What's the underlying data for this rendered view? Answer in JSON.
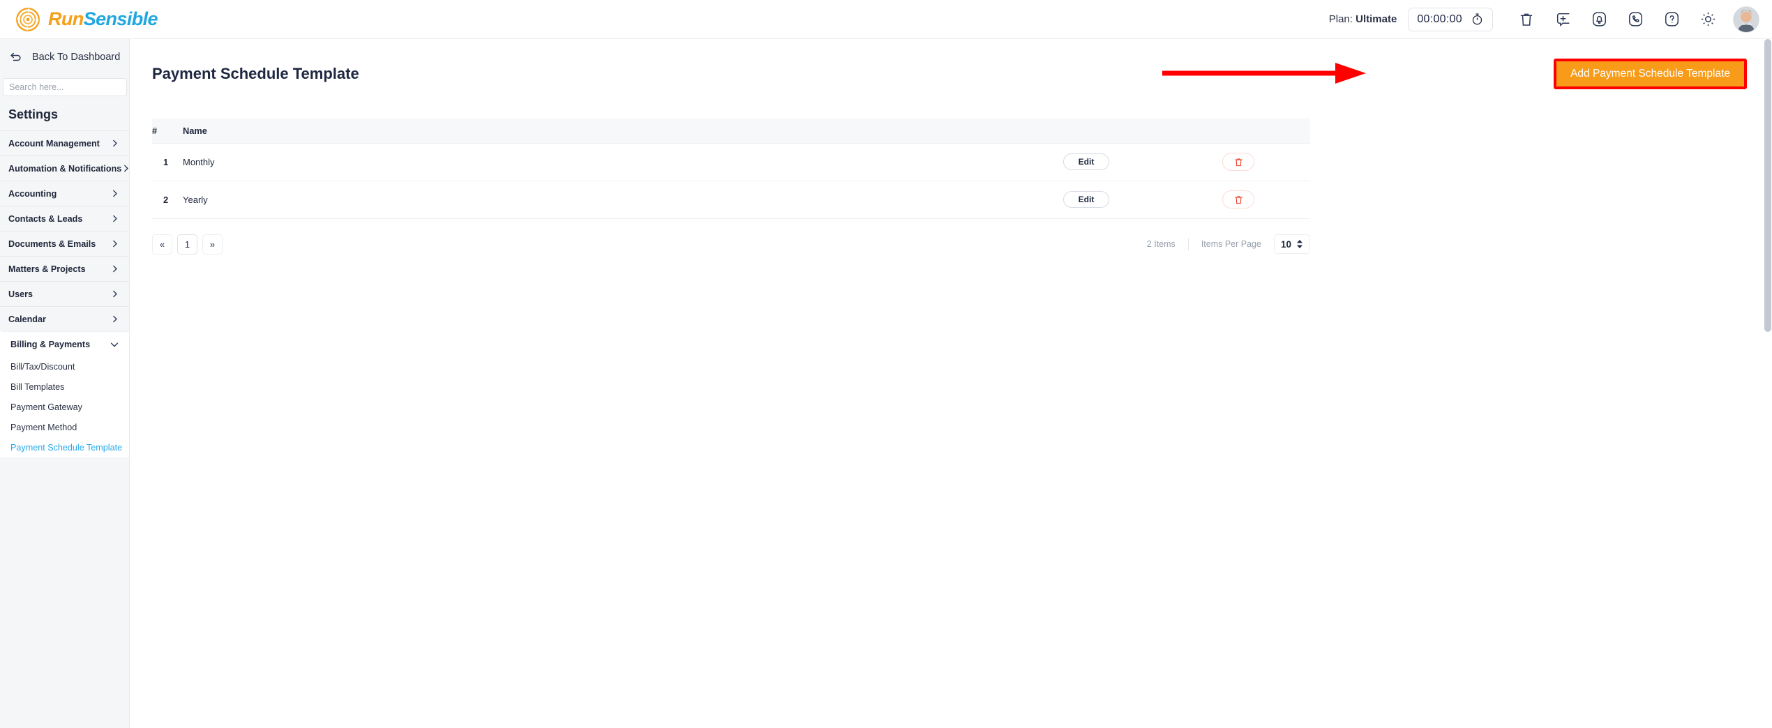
{
  "brand": {
    "run": "Run",
    "sensible": "Sensible"
  },
  "header": {
    "plan_prefix": "Plan:",
    "plan_value": "Ultimate",
    "timer": "00:00:00",
    "icons": [
      {
        "name": "stopwatch-icon"
      },
      {
        "name": "trash-icon"
      },
      {
        "name": "add-note-icon"
      },
      {
        "name": "notification-bell-icon"
      },
      {
        "name": "phone-icon"
      },
      {
        "name": "help-icon"
      },
      {
        "name": "settings-gear-icon"
      },
      {
        "name": "avatar"
      }
    ]
  },
  "sidebar": {
    "back_label": "Back To Dashboard",
    "search_placeholder": "Search here...",
    "search_value": "",
    "heading": "Settings",
    "items": [
      {
        "label": "Account Management",
        "expanded": false
      },
      {
        "label": "Automation & Notifications",
        "expanded": false
      },
      {
        "label": "Accounting",
        "expanded": false
      },
      {
        "label": "Contacts & Leads",
        "expanded": false
      },
      {
        "label": "Documents & Emails",
        "expanded": false
      },
      {
        "label": "Matters & Projects",
        "expanded": false
      },
      {
        "label": "Users",
        "expanded": false
      },
      {
        "label": "Calendar",
        "expanded": false
      }
    ],
    "open_group": {
      "label": "Billing & Payments",
      "expanded": true,
      "children": [
        {
          "label": "Bill/Tax/Discount",
          "active": false
        },
        {
          "label": "Bill Templates",
          "active": false
        },
        {
          "label": "Payment Gateway",
          "active": false
        },
        {
          "label": "Payment Method",
          "active": false
        },
        {
          "label": "Payment Schedule Template",
          "active": true
        }
      ]
    }
  },
  "main": {
    "title": "Payment Schedule Template",
    "add_button": "Add Payment Schedule Template",
    "table": {
      "columns": [
        "#",
        "Name"
      ],
      "rows": [
        {
          "num": "1",
          "name": "Monthly",
          "edit": "Edit",
          "delete": "delete-icon"
        },
        {
          "num": "2",
          "name": "Yearly",
          "edit": "Edit",
          "delete": "delete-icon"
        }
      ]
    },
    "pagination": {
      "first": "«",
      "pages": [
        "1"
      ],
      "last": "»",
      "current": "1"
    },
    "footer": {
      "items_count": "2 Items",
      "per_page_label": "Items Per Page",
      "per_page_value": "10"
    }
  },
  "annotation": {
    "arrow_color": "#ff0000",
    "highlight_color": "#ff0000",
    "button_color": "#f79b18"
  }
}
